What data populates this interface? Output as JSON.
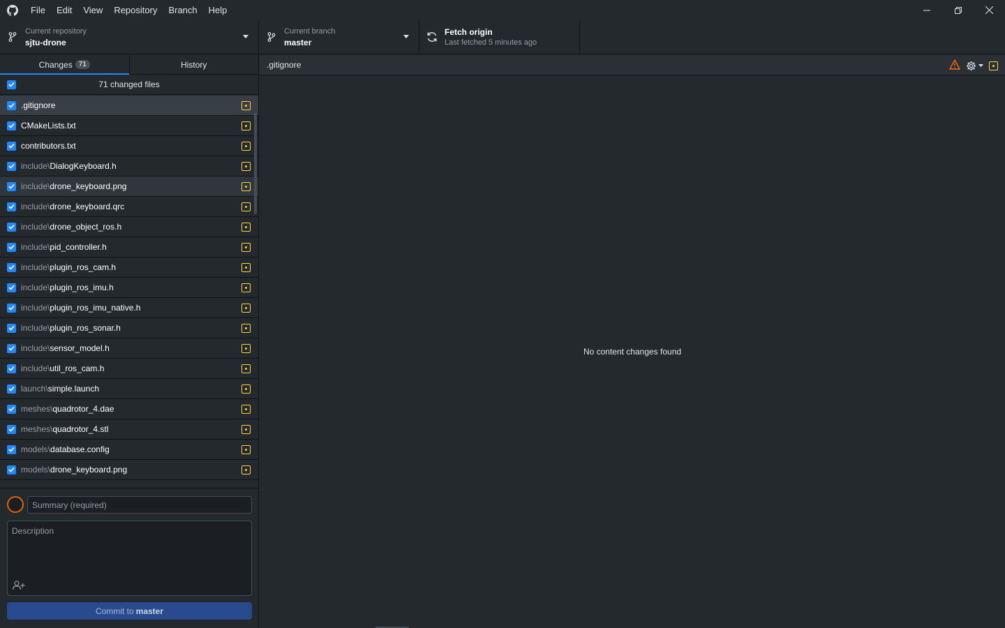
{
  "menu": [
    "File",
    "Edit",
    "View",
    "Repository",
    "Branch",
    "Help"
  ],
  "toolbar": {
    "repo_label": "Current repository",
    "repo_value": "sjtu-drone",
    "branch_label": "Current branch",
    "branch_value": "master",
    "fetch_label": "Fetch origin",
    "fetch_sub": "Last fetched 5 minutes ago"
  },
  "tabs": {
    "changes": "Changes",
    "changes_count": "71",
    "history": "History"
  },
  "file_header": "71 changed files",
  "files": [
    {
      "dir": "",
      "name": ".gitignore"
    },
    {
      "dir": "",
      "name": "CMakeLists.txt"
    },
    {
      "dir": "",
      "name": "contributors.txt"
    },
    {
      "dir": "include\\",
      "name": "DialogKeyboard.h"
    },
    {
      "dir": "include\\",
      "name": "drone_keyboard.png"
    },
    {
      "dir": "include\\",
      "name": "drone_keyboard.qrc"
    },
    {
      "dir": "include\\",
      "name": "drone_object_ros.h"
    },
    {
      "dir": "include\\",
      "name": "pid_controller.h"
    },
    {
      "dir": "include\\",
      "name": "plugin_ros_cam.h"
    },
    {
      "dir": "include\\",
      "name": "plugin_ros_imu.h"
    },
    {
      "dir": "include\\",
      "name": "plugin_ros_imu_native.h"
    },
    {
      "dir": "include\\",
      "name": "plugin_ros_sonar.h"
    },
    {
      "dir": "include\\",
      "name": "sensor_model.h"
    },
    {
      "dir": "include\\",
      "name": "util_ros_cam.h"
    },
    {
      "dir": "launch\\",
      "name": "simple.launch"
    },
    {
      "dir": "meshes\\",
      "name": "quadrotor_4.dae"
    },
    {
      "dir": "meshes\\",
      "name": "quadrotor_4.stl"
    },
    {
      "dir": "models\\",
      "name": "database.config"
    },
    {
      "dir": "models\\",
      "name": "drone_keyboard.png"
    }
  ],
  "commit": {
    "summary_placeholder": "Summary (required)",
    "description_placeholder": "Description",
    "button_prefix": "Commit to",
    "button_branch": "master"
  },
  "diff": {
    "filename": ".gitignore",
    "empty_message": "No content changes found"
  },
  "colors": {
    "accent": "#2188ff",
    "modified": "#ffd33d",
    "warning": "#f66a0a",
    "commit_button": "#2a4a8f"
  }
}
